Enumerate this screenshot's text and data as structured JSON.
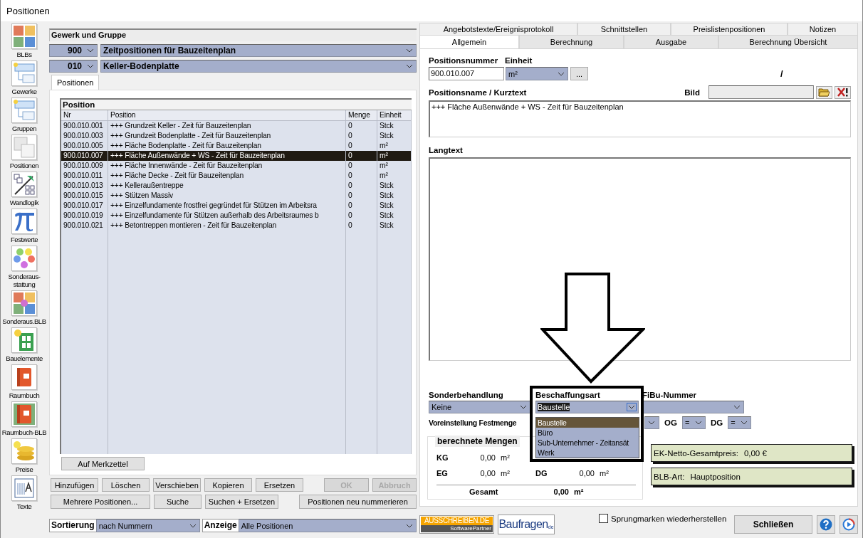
{
  "window": {
    "title": "Positionen"
  },
  "toolbar": [
    {
      "label": "BLBs"
    },
    {
      "label": "Gewerke"
    },
    {
      "label": "Gruppen"
    },
    {
      "label": "Positionen"
    },
    {
      "label": "Wandlogik"
    },
    {
      "label": "Festwerte"
    },
    {
      "label": "Sonderaus-\nstattung"
    },
    {
      "label": "Sonderaus.BLB"
    },
    {
      "label": "Bauelemente"
    },
    {
      "label": "Raumbuch"
    },
    {
      "label": "Raumbuch-BLB"
    },
    {
      "label": "Preise"
    },
    {
      "label": "Texte"
    }
  ],
  "gewerk_gruppe": {
    "title": "Gewerk und Gruppe",
    "rows": [
      {
        "code": "900",
        "name": "Zeitpositionen für Bauzeitenplan"
      },
      {
        "code": "010",
        "name": "Keller-Bodenplatte"
      }
    ]
  },
  "left_tabs": [
    {
      "label": "Positionen",
      "selected": true
    }
  ],
  "position_list": {
    "title": "Position",
    "columns": [
      "Nr",
      "Position",
      "Menge",
      "Einheit"
    ],
    "rows": [
      {
        "nr": "900.010.001",
        "position": "+++ Grundzeit Keller  - Zeit für Bauzeitenplan",
        "menge": "0",
        "einheit": "Stck",
        "selected": false
      },
      {
        "nr": "900.010.003",
        "position": "+++ Grundzeit Bodenplatte  - Zeit für Bauzeitenplan",
        "menge": "0",
        "einheit": "Stck",
        "selected": false
      },
      {
        "nr": "900.010.005",
        "position": "+++ Fläche Bodenplatte  - Zeit für Bauzeitenplan",
        "menge": "0",
        "einheit": "m²",
        "selected": false
      },
      {
        "nr": "900.010.007",
        "position": "+++ Fläche Außenwände + WS  - Zeit für Bauzeitenplan",
        "menge": "0",
        "einheit": "m²",
        "selected": true
      },
      {
        "nr": "900.010.009",
        "position": "+++ Fläche Innenwände  - Zeit für Bauzeitenplan",
        "menge": "0",
        "einheit": "m²",
        "selected": false
      },
      {
        "nr": "900.010.011",
        "position": "+++ Fläche Decke  - Zeit für Bauzeitenplan",
        "menge": "0",
        "einheit": "m²",
        "selected": false
      },
      {
        "nr": "900.010.013",
        "position": "+++ Kelleraußentreppe",
        "menge": "0",
        "einheit": "Stck",
        "selected": false
      },
      {
        "nr": "900.010.015",
        "position": "+++ Stützen Massiv",
        "menge": "0",
        "einheit": "Stck",
        "selected": false
      },
      {
        "nr": "900.010.017",
        "position": "+++ Einzelfundamente frostfrei gegründet für Stützen im Arbeitsra",
        "menge": "0",
        "einheit": "Stck",
        "selected": false
      },
      {
        "nr": "900.010.019",
        "position": "+++ Einzelfundamente für Stützen außerhalb des Arbeitsraumes b",
        "menge": "0",
        "einheit": "Stck",
        "selected": false
      },
      {
        "nr": "900.010.021",
        "position": "+++ Betontreppen montieren - Zeit für Bauzeitenplan",
        "menge": "0",
        "einheit": "Stck",
        "selected": false
      }
    ]
  },
  "merkzettel_button": "Auf Merkzettel",
  "action_rows": [
    [
      {
        "label": "Hinzufügen",
        "disabled": false
      },
      {
        "label": "Löschen",
        "disabled": false
      },
      {
        "label": "Verschieben",
        "disabled": false
      },
      {
        "label": "Kopieren",
        "disabled": false
      },
      {
        "label": "Ersetzen",
        "disabled": false
      },
      {
        "label": "OK",
        "disabled": true
      },
      {
        "label": "Abbruch",
        "disabled": true
      }
    ],
    [
      {
        "label": "Mehrere Positionen...",
        "disabled": false
      },
      {
        "label": "Suche",
        "disabled": false
      },
      {
        "label": "Suchen + Ersetzen",
        "disabled": false
      },
      {
        "label": "Positionen neu nummerieren",
        "disabled": false
      }
    ]
  ],
  "sort_bar": {
    "sort_label": "Sortierung",
    "sort_value": "nach Nummern",
    "view_label": "Anzeige",
    "view_value": "Alle Positionen"
  },
  "detail_tabs": [
    [
      {
        "label": "Angebotstexte/Ereignisprotokoll",
        "selected": false
      },
      {
        "label": "Schnittstellen",
        "selected": false
      },
      {
        "label": "Preislistenpositionen",
        "selected": false
      },
      {
        "label": "Notizen",
        "selected": false
      }
    ],
    [
      {
        "label": "Allgemein",
        "selected": true
      },
      {
        "label": "Berechnung",
        "selected": false
      },
      {
        "label": "Ausgabe",
        "selected": false
      },
      {
        "label": "Berechnung Übersicht",
        "selected": false
      }
    ]
  ],
  "allgemein": {
    "positionsnummer_label": "Positionsnummer",
    "positionsnummer": "900.010.007",
    "einheit_label": "Einheit",
    "einheit": "m²",
    "more_button": "...",
    "slash": "/",
    "kurztext_label": "Positionsname / Kurztext",
    "bild_label": "Bild",
    "kurztext": "+++ Fläche Außenwände + WS  - Zeit für Bauzeitenplan",
    "langtext_label": "Langtext",
    "sonderbehandlung_label": "Sonderbehandlung",
    "sonderbehandlung": "Keine",
    "beschaffungsart_label": "Beschaffungsart",
    "beschaffungsart": "Baustelle",
    "beschaffungsart_focused": true,
    "fibu_label": "FiBu-Nummer",
    "voreinstellung_label": "Voreinstellung Festmenge",
    "og_label": "OG",
    "og_value": "=",
    "dg_label": "DG",
    "dg_value": "="
  },
  "beschaffungsart_options": [
    {
      "label": "Baustelle",
      "selected": true
    },
    {
      "label": "Büro",
      "selected": false
    },
    {
      "label": "Sub-Unternehmer - Zeitansät",
      "selected": false
    },
    {
      "label": "Werk",
      "selected": false
    }
  ],
  "mengen": {
    "title": "berechnete Mengen",
    "rows": [
      [
        {
          "label": "KG",
          "value": "0,00",
          "unit": "m²"
        }
      ],
      [
        {
          "label": "EG",
          "value": "0,00",
          "unit": "m²"
        },
        {
          "label": "DG",
          "value": "0,00",
          "unit": "m²"
        }
      ]
    ],
    "total_label": "Gesamt",
    "total_value": "0,00",
    "total_unit": "m²"
  },
  "info_boxes": [
    {
      "label": "EK-Netto-Gesamtpreis:",
      "value": "0,00 €"
    },
    {
      "label": "BLB-Art:",
      "value": "Hauptposition"
    }
  ],
  "footer": {
    "logo_1_top": "AUSSCHREIBEN.DE",
    "logo_1_bottom": "SoftwarePartner",
    "logo_2": "Baufragen",
    "logo_2_suffix": "de",
    "checkbox": {
      "label": "Sprungmarken wiederherstellen",
      "checked": false
    },
    "close_button": "Schließen"
  }
}
